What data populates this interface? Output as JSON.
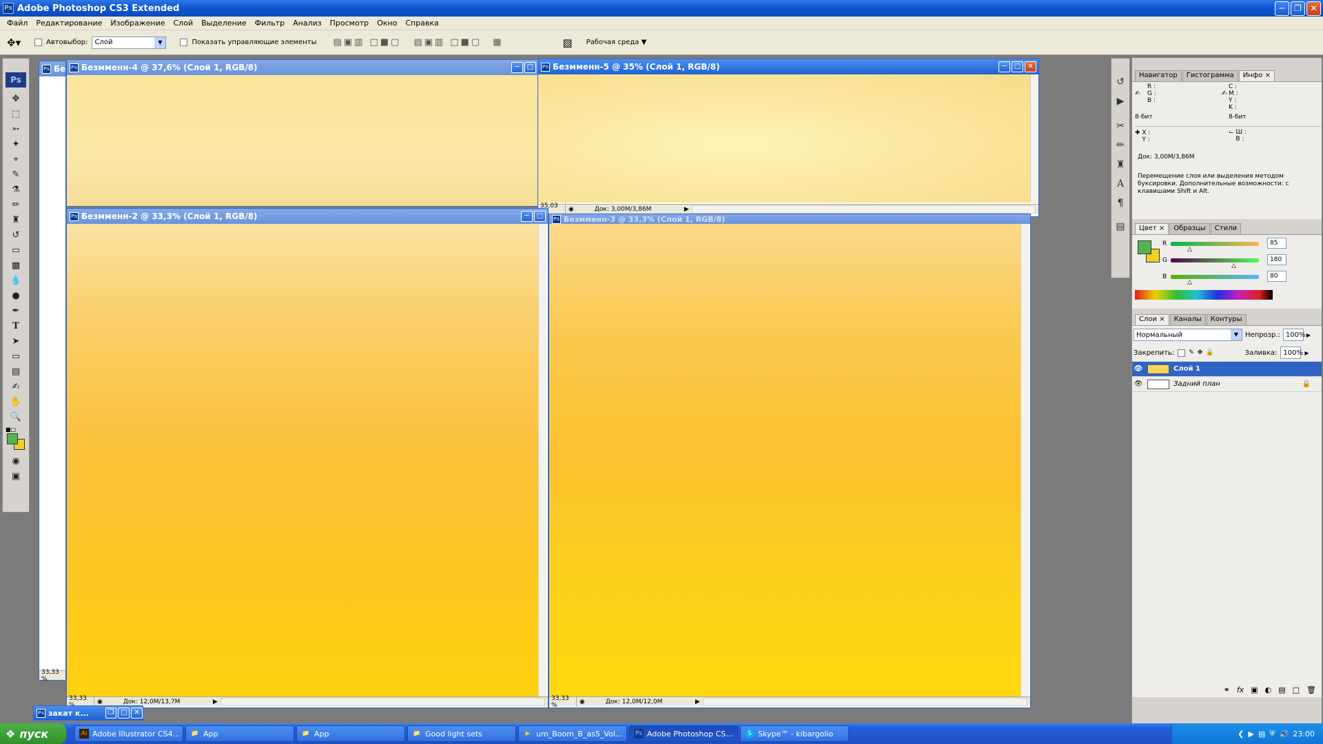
{
  "app": {
    "title": "Adobe Photoshop CS3 Extended",
    "icon_text": "Ps"
  },
  "menu": [
    "Файл",
    "Редактирование",
    "Изображение",
    "Слой",
    "Выделение",
    "Фильтр",
    "Анализ",
    "Просмотр",
    "Окно",
    "Справка"
  ],
  "options": {
    "autoselect_label": "Автовыбор:",
    "autoselect_value": "Слой",
    "show_controls_label": "Показать управляющие элементы",
    "workspace_label": "Рабочая среда"
  },
  "documents": {
    "behind": {
      "title": "Бе",
      "zoom": "33,33 %"
    },
    "doc4": {
      "title": "Безмменн-4 @ 37,6% (Слой 1, RGB/8)"
    },
    "doc5": {
      "title": "Безмменн-5 @ 35% (Слой 1, RGB/8)",
      "zoom": "35,03 %",
      "doc": "Док: 3,00M/3,86M"
    },
    "doc2": {
      "title": "Безмменн-2 @ 33,3% (Слой 1, RGB/8)",
      "zoom": "33,33 %",
      "doc": "Док: 12,0M/13,7M"
    },
    "doc3": {
      "title": "Безмменн-3 @ 33,3% (Слой 1, RGB/8)",
      "zoom": "33,33 %",
      "doc": "Док: 12,0M/12,0M"
    },
    "minimized": {
      "title": "закат к..."
    }
  },
  "panels": {
    "info_tabs": [
      "Навигатор",
      "Гистограмма",
      "Инфо"
    ],
    "info": {
      "left_channels": "R :\nG :\nB :",
      "right_channels": "C :\nM :\nY :\nK :",
      "bits_left": "8-бит",
      "bits_right": "8-бит",
      "xy": "X :\nY :",
      "wh": "Ш :\nВ :",
      "doc": "Док: 3,00M/3,86M",
      "hint": "Перемещение слоя или выделения методом буксировки.  Дополнительные возможности: с клавишами Shift и Alt."
    },
    "color_tabs": [
      "Цвет",
      "Образцы",
      "Стили"
    ],
    "color": {
      "r_label": "R",
      "g_label": "G",
      "b_label": "B",
      "r": "85",
      "g": "180",
      "b": "80",
      "foreground": "#55b450",
      "background": "#f0d020"
    },
    "layers_tabs": [
      "Слои",
      "Каналы",
      "Контуры"
    ],
    "layers": {
      "blend_mode": "Нормальный",
      "opacity_label": "Непрозр.:",
      "opacity": "100%",
      "lock_label": "Закрепить:",
      "fill_label": "Заливка:",
      "fill": "100%",
      "items": [
        {
          "name": "Слой 1",
          "selected": true
        },
        {
          "name": "Задний план",
          "selected": false
        }
      ]
    }
  },
  "taskbar": {
    "start": "пуск",
    "items": [
      {
        "label": "Adobe Illustrator CS4...",
        "icon": "Ai"
      },
      {
        "label": "App",
        "icon": "folder"
      },
      {
        "label": "App",
        "icon": "folder"
      },
      {
        "label": "Good light sets",
        "icon": "folder"
      },
      {
        "label": "um_Boom_B_as5_Vol...",
        "icon": "media"
      },
      {
        "label": "Adobe Photoshop CS...",
        "icon": "Ps"
      },
      {
        "label": "Skype™ - kibargolio",
        "icon": "S"
      }
    ],
    "clock": "23:00"
  },
  "colors": {
    "sky_top": "#fbe29a",
    "sky_mid": "#fbc838",
    "sky_bottom": "#ffd410",
    "titlebar": "#1e62d4"
  }
}
